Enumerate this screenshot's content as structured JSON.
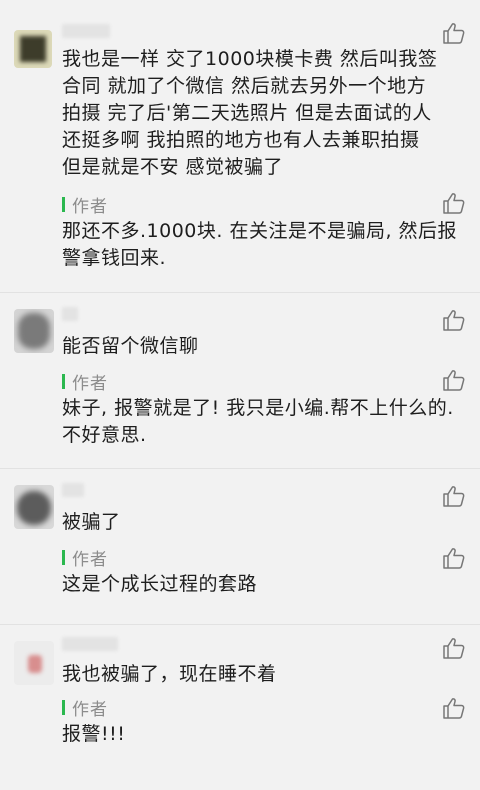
{
  "icons": {
    "like": "thumbs-up-outline-icon"
  },
  "colors": {
    "author_bar": "#2bb84f",
    "background": "#f2f2f2"
  },
  "comments": [
    {
      "lines": [
        "我也是一样  交了1000块模卡费   然后叫我签",
        "合同  就加了个微信   然后就去另外一个地方",
        "拍摄   完了后'第二天选照片   但是去面试的人",
        "还挺多啊   我拍照的地方也有人去兼职拍摄",
        "但是就是不安  感觉被骗了"
      ],
      "author_label": "作者",
      "reply_lines": [
        "那还不多.1000块. 在关注是不是骗局, 然后报",
        "警拿钱回来."
      ]
    },
    {
      "lines": [
        "能否留个微信聊"
      ],
      "author_label": "作者",
      "reply_lines": [
        "妹子, 报警就是了! 我只是小编.帮不上什么的.",
        "不好意思."
      ]
    },
    {
      "lines": [
        "被骗了"
      ],
      "author_label": "作者",
      "reply_lines": [
        "这是个成长过程的套路"
      ]
    },
    {
      "lines": [
        "我也被骗了，现在睡不着"
      ],
      "author_label": "作者",
      "reply_lines": [
        "报警!!!"
      ]
    }
  ]
}
